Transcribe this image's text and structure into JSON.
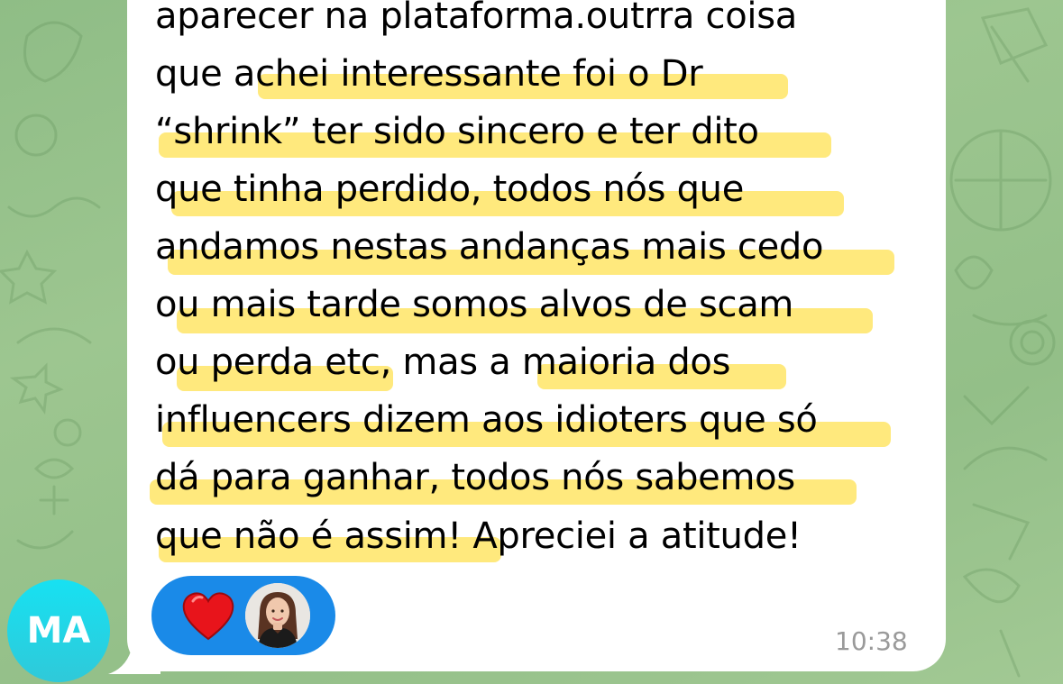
{
  "conversation": {
    "message": {
      "lines": [
        "aparecer na plataforma.outrra coisa",
        "que achei interessante foi o Dr",
        "“shrink” ter sido sincero e ter dito",
        "que tinha perdido, todos nós que",
        "andamos nestas andanças mais cedo",
        "ou mais tarde somos alvos de scam",
        "ou perda etc, mas a maioria dos",
        "influencers dizem aos idioters que só",
        "dá para ganhar, todos nós sabemos",
        "que não é assim! Apreciei a atitude!"
      ],
      "timestamp": "10:38",
      "highlight_color": "#ffe566",
      "reaction": {
        "emoji": "heart-icon",
        "heart_color": "#e8141b",
        "pill_color": "#1a8ae8"
      }
    },
    "sender": {
      "initials": "MA",
      "avatar_gradient_top": "#17e1f2",
      "avatar_gradient_bottom": "#2fc9d9"
    },
    "background_color": "#97c48b"
  }
}
